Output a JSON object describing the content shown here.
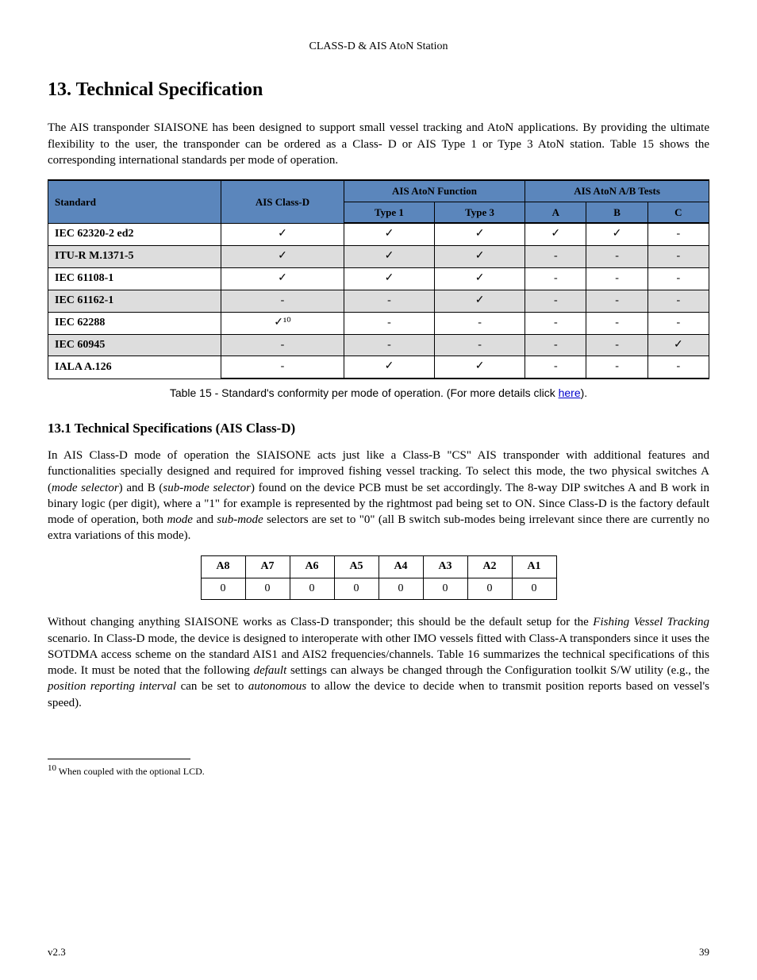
{
  "header": {
    "running_head": "CLASS-D & AIS AtoN Station"
  },
  "section_title": "13. Technical Specification",
  "intro_para": "The AIS transponder SIAISONE has been designed to support small vessel tracking and AtoN applications. By providing the ultimate flexibility to the user, the transponder can be ordered as a Class-",
  "intro_para2_prefix": "D",
  "intro_para2_rest": " or AIS Type 1 or Type 3 AtoN station. Table 15 shows the corresponding international standards per mode of operation.",
  "table15": {
    "group_headers": [
      "Standard",
      "AIS Class-D",
      "AIS AtoN Function",
      "AIS AtoN A/B Tests"
    ],
    "sub_headers": [
      "",
      "",
      "Type 1",
      "Type 3",
      "A",
      "B",
      "C"
    ],
    "rows": [
      {
        "label": "IEC 62320-2 ed2",
        "cells": [
          "✓",
          "✓",
          "✓",
          "✓",
          "✓",
          "-"
        ]
      },
      {
        "label": "ITU-R M.1371-5",
        "cells": [
          "✓",
          "✓",
          "✓",
          "-",
          "-",
          "-"
        ]
      },
      {
        "label": "IEC 61108-1",
        "cells": [
          "✓",
          "✓",
          "✓",
          "-",
          "-",
          "-"
        ]
      },
      {
        "label": "IEC 61162-1",
        "cells": [
          "-",
          "-",
          "✓",
          "-",
          "-",
          "-"
        ]
      },
      {
        "label": "IEC 62288",
        "cells": [
          "✓¹⁰",
          "-",
          "-",
          "-",
          "-",
          "-"
        ]
      },
      {
        "label": "IEC 60945",
        "cells": [
          "-",
          "-",
          "-",
          "-",
          "-",
          "✓"
        ]
      },
      {
        "label": "IALA A.126",
        "cells": [
          "-",
          "✓",
          "✓",
          "-",
          "-",
          "-"
        ]
      }
    ]
  },
  "caption": {
    "lead": "Table 15 - Standard's conformity per mode of operation. (For more details click ",
    "link_text": "here",
    "tail": ")."
  },
  "subsection_title": "13.1 Technical Specifications (AIS Class-D)",
  "p1_a": "In AIS Class-D mode of operation the SIAISONE acts just like a Class-B \"CS\" AIS transponder with additional features and functionalities specially designed and required for improved fishing vessel tracking. To select this mode, the two physical switches A (",
  "p1_italic1": "mode selector",
  "p1_b": ") and B (",
  "p1_italic2": "sub-mode selector",
  "p1_c": ") found on the device PCB must be set accordingly. The 8-way DIP switches A and B work in binary logic (per digit), where a \"1\" for example is represented by the rightmost pad being set to ON. Since Class-D is the factory default mode of operation, both ",
  "p1_italic3": "mode",
  "p1_d": " and ",
  "p1_italic4": "sub-mode",
  "p1_e": " selectors are set to \"0\" (all B switch sub-modes being irrelevant since there are currently no extra variations of this mode).",
  "dip": {
    "headers": [
      "A8",
      "A7",
      "A6",
      "A5",
      "A4",
      "A3",
      "A2",
      "A1"
    ],
    "values": [
      "0",
      "0",
      "0",
      "0",
      "0",
      "0",
      "0",
      "0"
    ]
  },
  "p2_a": "Without changing anything SIAISONE works as Class-D transponder; this should be the default setup for the ",
  "p2_italic1": "Fishing Vessel Tracking",
  "p2_b": " scenario. In Class-D mode, the device is designed to interoperate with other IMO vessels fitted with Class-A transponders since it uses the SOTDMA access scheme on the standard AIS1 and AIS2 frequencies/channels. Table 16 summarizes the technical specifications of this mode. It must be noted that the following ",
  "p2_italic2": "default",
  "p2_c": " settings can always be changed through the Configuration toolkit S/W utility (e.g., the ",
  "p2_italic3": "position reporting interval",
  "p2_d": " can be set to ",
  "p2_italic4": "autonomous",
  "p2_e": " to allow the device to decide when to transmit position reports based on vessel's speed).",
  "footnote": {
    "num": "10",
    "text": " When coupled with the optional LCD."
  },
  "footer": {
    "version": "v2.3",
    "page": "39"
  }
}
